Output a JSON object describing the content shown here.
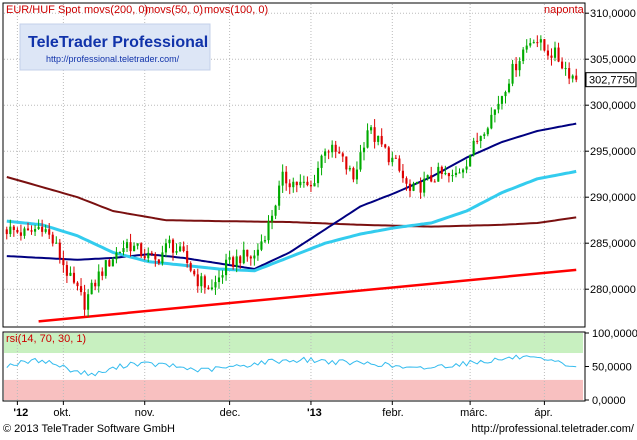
{
  "chart_data": [
    {
      "type": "line",
      "subtype": "candlestick",
      "legend": {
        "instrument": "EUR/HUF Spot",
        "indicators": [
          "movs(200, 0)",
          "movs(50, 0)",
          "movs(100, 0)"
        ]
      },
      "interval_label": "naponta",
      "watermark": {
        "brand": "TeleTrader Professional",
        "url": "http://professional.teletrader.com/"
      },
      "ylim": [
        276.0,
        311.0
      ],
      "yticks": [
        "280,0000",
        "285,0000",
        "290,0000",
        "295,0000",
        "300,0000",
        "305,0000",
        "310,0000"
      ],
      "ytick_values": [
        280,
        285,
        290,
        295,
        300,
        305,
        310
      ],
      "last_price": {
        "label": "302,7750",
        "value": 302.775
      },
      "xticks": [
        "'12",
        "okt.",
        "nov.",
        "dec.",
        "'13",
        "febr.",
        "márc.",
        "ápr."
      ],
      "xtick_positions": [
        3,
        16,
        39,
        63,
        86,
        109,
        131,
        152
      ],
      "n_days": 162,
      "close_keypoints": [
        [
          0,
          286.5
        ],
        [
          6,
          286.0
        ],
        [
          10,
          287.0
        ],
        [
          14,
          284.5
        ],
        [
          18,
          281.0
        ],
        [
          22,
          278.5
        ],
        [
          26,
          281.5
        ],
        [
          30,
          283.5
        ],
        [
          34,
          285.0
        ],
        [
          38,
          284.0
        ],
        [
          42,
          283.0
        ],
        [
          46,
          285.0
        ],
        [
          50,
          283.5
        ],
        [
          54,
          281.0
        ],
        [
          58,
          280.0
        ],
        [
          62,
          282.5
        ],
        [
          66,
          283.5
        ],
        [
          70,
          283.5
        ],
        [
          74,
          287.0
        ],
        [
          78,
          292.0
        ],
        [
          82,
          291.5
        ],
        [
          86,
          291.0
        ],
        [
          90,
          295.5
        ],
        [
          94,
          294.5
        ],
        [
          98,
          292.0
        ],
        [
          102,
          297.5
        ],
        [
          106,
          295.5
        ],
        [
          110,
          293.5
        ],
        [
          114,
          290.5
        ],
        [
          118,
          291.5
        ],
        [
          122,
          292.5
        ],
        [
          126,
          292.0
        ],
        [
          130,
          294.0
        ],
        [
          134,
          297.0
        ],
        [
          138,
          299.5
        ],
        [
          142,
          303.0
        ],
        [
          146,
          306.0
        ],
        [
          149,
          307.5
        ],
        [
          152,
          306.0
        ],
        [
          155,
          305.5
        ],
        [
          158,
          304.0
        ],
        [
          161,
          302.775
        ]
      ],
      "series": [
        {
          "name": "movs(200, 0)",
          "color": "#7a1010",
          "keypoints": [
            [
              0,
              292.2
            ],
            [
              20,
              290.0
            ],
            [
              30,
              288.5
            ],
            [
              45,
              287.5
            ],
            [
              60,
              287.4
            ],
            [
              80,
              287.3
            ],
            [
              100,
              287.0
            ],
            [
              120,
              286.8
            ],
            [
              140,
              287.0
            ],
            [
              150,
              287.2
            ],
            [
              161,
              287.8
            ]
          ]
        },
        {
          "name": "movs(50, 0)",
          "color": "#000080",
          "keypoints": [
            [
              0,
              283.6
            ],
            [
              20,
              283.2
            ],
            [
              30,
              283.4
            ],
            [
              40,
              283.8
            ],
            [
              50,
              283.4
            ],
            [
              60,
              282.8
            ],
            [
              70,
              282.2
            ],
            [
              80,
              284.0
            ],
            [
              90,
              286.5
            ],
            [
              100,
              289.0
            ],
            [
              110,
              290.5
            ],
            [
              120,
              292.2
            ],
            [
              130,
              294.3
            ],
            [
              140,
              296.0
            ],
            [
              150,
              297.2
            ],
            [
              161,
              298.0
            ]
          ]
        },
        {
          "name": "movs(100, 0)",
          "color": "#33ccee",
          "keypoints": [
            [
              0,
              287.4
            ],
            [
              10,
              287.0
            ],
            [
              20,
              285.8
            ],
            [
              30,
              284.0
            ],
            [
              40,
              283.0
            ],
            [
              50,
              282.6
            ],
            [
              60,
              282.2
            ],
            [
              70,
              282.0
            ],
            [
              80,
              283.5
            ],
            [
              90,
              285.0
            ],
            [
              100,
              286.0
            ],
            [
              110,
              286.7
            ],
            [
              120,
              287.2
            ],
            [
              130,
              288.5
            ],
            [
              140,
              290.5
            ],
            [
              150,
              292.0
            ],
            [
              161,
              292.8
            ]
          ]
        },
        {
          "name": "trend",
          "color": "#ff0000",
          "keypoints": [
            [
              9,
              276.5
            ],
            [
              161,
              282.1
            ]
          ]
        }
      ]
    },
    {
      "type": "line",
      "legend": {
        "label": "rsi(14, 70, 30, 1)"
      },
      "ylim": [
        0,
        100
      ],
      "yticks": [
        "100,0000",
        "50,0000",
        "0,0000"
      ],
      "ytick_values": [
        100,
        50,
        0
      ],
      "bands": {
        "upper": 70,
        "lower": 30,
        "upper_color": "#c8f0c0",
        "lower_color": "#f8c0c0",
        "mid_color": "#ffffff"
      },
      "series": [
        {
          "name": "rsi",
          "color": "#33bbee",
          "keypoints": [
            [
              0,
              52
            ],
            [
              10,
              60
            ],
            [
              20,
              42
            ],
            [
              25,
              38
            ],
            [
              35,
              55
            ],
            [
              45,
              52
            ],
            [
              55,
              44
            ],
            [
              65,
              50
            ],
            [
              75,
              58
            ],
            [
              85,
              60
            ],
            [
              95,
              56
            ],
            [
              105,
              54
            ],
            [
              115,
              46
            ],
            [
              125,
              52
            ],
            [
              135,
              58
            ],
            [
              145,
              64
            ],
            [
              150,
              60
            ],
            [
              155,
              56
            ],
            [
              161,
              50
            ]
          ]
        }
      ]
    }
  ],
  "footer": {
    "copyright": "© 2013 TeleTrader Software GmbH",
    "url": "http://professional.teletrader.com/"
  },
  "colors": {
    "accent": "#1133aa",
    "axis_text": "#000000",
    "up": "#00aa00",
    "down": "#dd0000",
    "frame": "#000000"
  }
}
